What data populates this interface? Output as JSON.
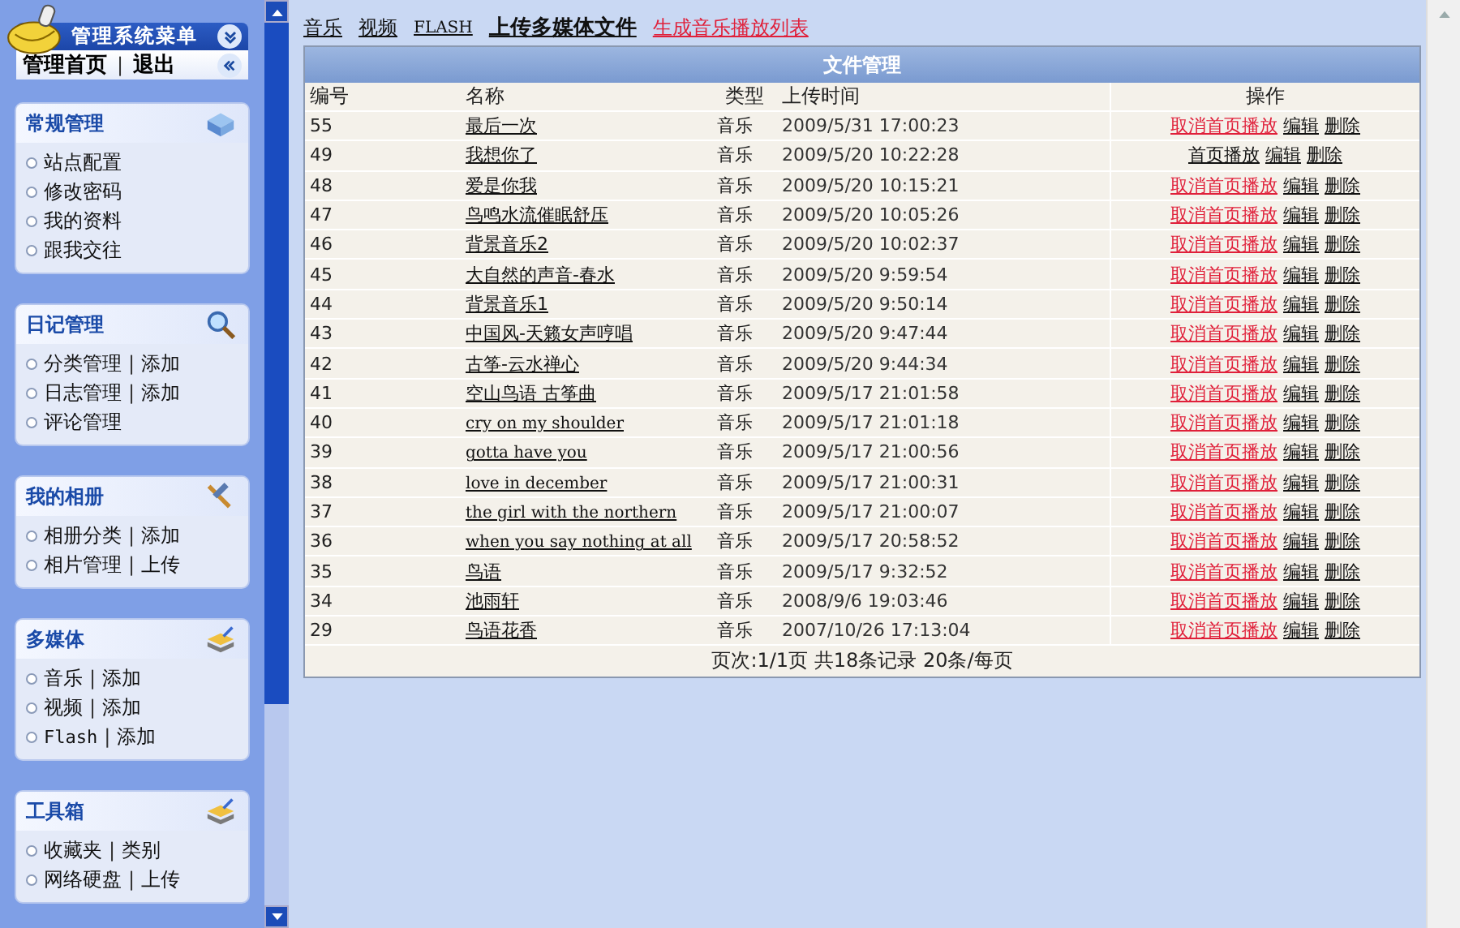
{
  "menu": {
    "title": "管理系统菜单",
    "home": "管理首页",
    "separator": "|",
    "logout": "退出"
  },
  "sidebar": {
    "panels": [
      {
        "title": "常规管理",
        "items": [
          {
            "label": "站点配置"
          },
          {
            "label": "修改密码"
          },
          {
            "label": "我的资料"
          },
          {
            "label": "跟我交往"
          }
        ]
      },
      {
        "title": "日记管理",
        "items": [
          {
            "label": "分类管理",
            "separator": "|",
            "extra": "添加"
          },
          {
            "label": "日志管理",
            "separator": "|",
            "extra": "添加"
          },
          {
            "label": "评论管理"
          }
        ]
      },
      {
        "title": "我的相册",
        "items": [
          {
            "label": "相册分类",
            "separator": "|",
            "extra": "添加"
          },
          {
            "label": "相片管理",
            "separator": "|",
            "extra": "上传"
          }
        ]
      },
      {
        "title": "多媒体",
        "items": [
          {
            "label": "音乐",
            "separator": "|",
            "extra": "添加"
          },
          {
            "label": "视频",
            "separator": "|",
            "extra": "添加"
          },
          {
            "label": "Flash",
            "separator": "|",
            "extra": "添加"
          }
        ]
      },
      {
        "title": "工具箱",
        "items": [
          {
            "label": "收藏夹",
            "separator": "|",
            "extra": "类别"
          },
          {
            "label": "网络硬盘",
            "separator": "|",
            "extra": "上传"
          }
        ]
      }
    ]
  },
  "nav": [
    {
      "label": "音乐",
      "kind": "plain"
    },
    {
      "label": "视频",
      "kind": "plain"
    },
    {
      "label": "FLASH",
      "kind": "mono"
    },
    {
      "label": "上传多媒体文件",
      "kind": "bold"
    },
    {
      "label": "生成音乐播放列表",
      "kind": "red"
    }
  ],
  "table": {
    "title": "文件管理",
    "columns": [
      "编号",
      "名称",
      "类型",
      "上传时间",
      "操作"
    ],
    "rows": [
      {
        "id": "55",
        "name": "最后一次",
        "type": "音乐",
        "time": "2009/5/31 17:00:23",
        "featured": true,
        "toggle": "取消首页播放",
        "edit": "编辑",
        "delete": "删除"
      },
      {
        "id": "49",
        "name": "我想你了",
        "type": "音乐",
        "time": "2009/5/20 10:22:28",
        "featured": false,
        "toggle": "首页播放",
        "edit": "编辑",
        "delete": "删除"
      },
      {
        "id": "48",
        "name": "爱是你我",
        "type": "音乐",
        "time": "2009/5/20 10:15:21",
        "featured": true,
        "toggle": "取消首页播放",
        "edit": "编辑",
        "delete": "删除"
      },
      {
        "id": "47",
        "name": "鸟鸣水流催眠舒压",
        "type": "音乐",
        "time": "2009/5/20 10:05:26",
        "featured": true,
        "toggle": "取消首页播放",
        "edit": "编辑",
        "delete": "删除"
      },
      {
        "id": "46",
        "name": "背景音乐2",
        "type": "音乐",
        "time": "2009/5/20 10:02:37",
        "featured": true,
        "toggle": "取消首页播放",
        "edit": "编辑",
        "delete": "删除"
      },
      {
        "id": "45",
        "name": "大自然的声音-春水",
        "type": "音乐",
        "time": "2009/5/20 9:59:54",
        "featured": true,
        "toggle": "取消首页播放",
        "edit": "编辑",
        "delete": "删除"
      },
      {
        "id": "44",
        "name": "背景音乐1",
        "type": "音乐",
        "time": "2009/5/20 9:50:14",
        "featured": true,
        "toggle": "取消首页播放",
        "edit": "编辑",
        "delete": "删除"
      },
      {
        "id": "43",
        "name": "中国风-天籁女声哼唱",
        "type": "音乐",
        "time": "2009/5/20 9:47:44",
        "featured": true,
        "toggle": "取消首页播放",
        "edit": "编辑",
        "delete": "删除"
      },
      {
        "id": "42",
        "name": "古筝-云水禅心",
        "type": "音乐",
        "time": "2009/5/20 9:44:34",
        "featured": true,
        "toggle": "取消首页播放",
        "edit": "编辑",
        "delete": "删除"
      },
      {
        "id": "41",
        "name": "空山鸟语 古筝曲",
        "type": "音乐",
        "time": "2009/5/17 21:01:58",
        "featured": true,
        "toggle": "取消首页播放",
        "edit": "编辑",
        "delete": "删除"
      },
      {
        "id": "40",
        "name": "cry on my shoulder",
        "type": "音乐",
        "time": "2009/5/17 21:01:18",
        "featured": true,
        "toggle": "取消首页播放",
        "edit": "编辑",
        "delete": "删除"
      },
      {
        "id": "39",
        "name": "gotta have you",
        "type": "音乐",
        "time": "2009/5/17 21:00:56",
        "featured": true,
        "toggle": "取消首页播放",
        "edit": "编辑",
        "delete": "删除"
      },
      {
        "id": "38",
        "name": "love in december",
        "type": "音乐",
        "time": "2009/5/17 21:00:31",
        "featured": true,
        "toggle": "取消首页播放",
        "edit": "编辑",
        "delete": "删除"
      },
      {
        "id": "37",
        "name": "the girl with the northern",
        "type": "音乐",
        "time": "2009/5/17 21:00:07",
        "featured": true,
        "toggle": "取消首页播放",
        "edit": "编辑",
        "delete": "删除"
      },
      {
        "id": "36",
        "name": "when you say nothing at all",
        "type": "音乐",
        "time": "2009/5/17 20:58:52",
        "featured": true,
        "toggle": "取消首页播放",
        "edit": "编辑",
        "delete": "删除"
      },
      {
        "id": "35",
        "name": "鸟语",
        "type": "音乐",
        "time": "2009/5/17 9:32:52",
        "featured": true,
        "toggle": "取消首页播放",
        "edit": "编辑",
        "delete": "删除"
      },
      {
        "id": "34",
        "name": "池雨轩",
        "type": "音乐",
        "time": "2008/9/6 19:03:46",
        "featured": true,
        "toggle": "取消首页播放",
        "edit": "编辑",
        "delete": "删除"
      },
      {
        "id": "29",
        "name": "鸟语花香",
        "type": "音乐",
        "time": "2007/10/26 17:13:04",
        "featured": true,
        "toggle": "取消首页播放",
        "edit": "编辑",
        "delete": "删除"
      }
    ],
    "footer": "页次:1/1页 共18条记录 20条/每页"
  }
}
